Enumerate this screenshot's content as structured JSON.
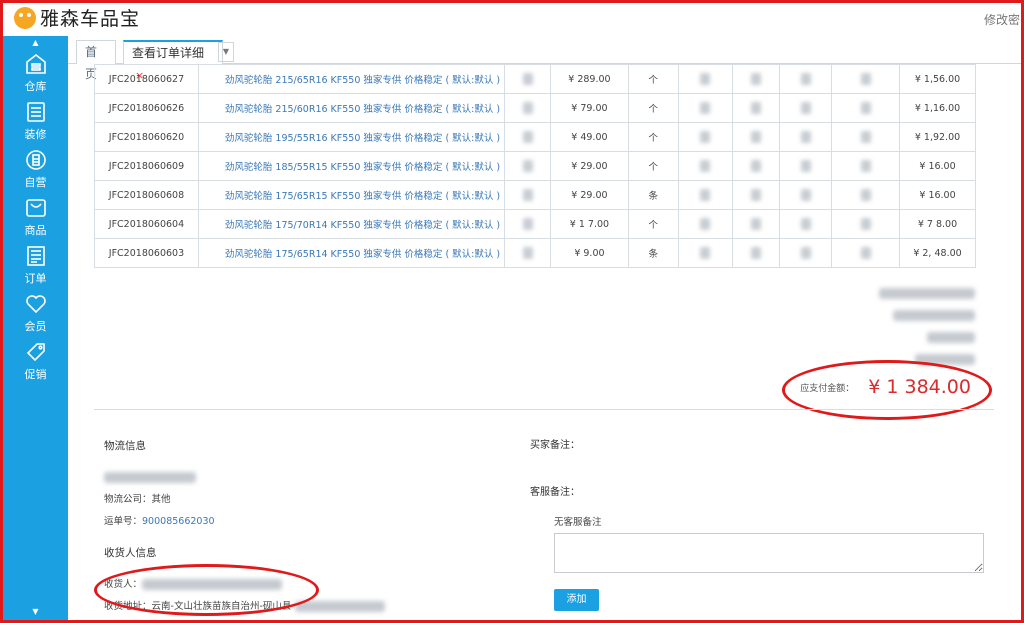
{
  "app": {
    "title": "雅森车品宝",
    "top_right": "修改密"
  },
  "sidebar": {
    "items": [
      {
        "label": "仓库",
        "icon": "warehouse-icon"
      },
      {
        "label": "装修",
        "icon": "decor-icon"
      },
      {
        "label": "自营",
        "icon": "self-op-icon"
      },
      {
        "label": "商品",
        "icon": "goods-icon"
      },
      {
        "label": "订单",
        "icon": "order-icon"
      },
      {
        "label": "会员",
        "icon": "heart-icon"
      },
      {
        "label": "促销",
        "icon": "tag-icon"
      }
    ]
  },
  "tabs": [
    {
      "label": "首页"
    },
    {
      "label": "查看订单详细",
      "close": "×"
    }
  ],
  "orders": {
    "rows": [
      {
        "sku": "JFC2018060627",
        "desc": "劲风驼轮胎 215/65R16 KF550 独家专供 价格稳定 ( 默认:默认 )",
        "price": "¥ 289.00",
        "unit": "个",
        "total": "¥ 1,56.00"
      },
      {
        "sku": "JFC2018060626",
        "desc": "劲风驼轮胎 215/60R16 KF550 独家专供 价格稳定 ( 默认:默认 )",
        "price": "¥ 79.00",
        "unit": "个",
        "total": "¥ 1,16.00"
      },
      {
        "sku": "JFC2018060620",
        "desc": "劲风驼轮胎 195/55R16 KF550 独家专供 价格稳定 ( 默认:默认 )",
        "price": "¥ 49.00",
        "unit": "个",
        "total": "¥ 1,92.00"
      },
      {
        "sku": "JFC2018060609",
        "desc": "劲风驼轮胎 185/55R15 KF550 独家专供 价格稳定 ( 默认:默认 )",
        "price": "¥ 29.00",
        "unit": "个",
        "total": "¥ 16.00"
      },
      {
        "sku": "JFC2018060608",
        "desc": "劲风驼轮胎 175/65R15 KF550 独家专供 价格稳定 ( 默认:默认 )",
        "price": "¥ 29.00",
        "unit": "条",
        "total": "¥ 16.00"
      },
      {
        "sku": "JFC2018060604",
        "desc": "劲风驼轮胎 175/70R14 KF550 独家专供 价格稳定 ( 默认:默认 )",
        "price": "¥ 1 7.00",
        "unit": "个",
        "total": "¥ 7 8.00"
      },
      {
        "sku": "JFC2018060603",
        "desc": "劲风驼轮胎 175/65R14 KF550 独家专供 价格稳定 ( 默认:默认 )",
        "price": "¥ 9.00",
        "unit": "条",
        "total": "¥ 2, 48.00"
      }
    ]
  },
  "summary": {
    "payable_label": "应支付金额：",
    "payable_amount": "¥ 1 384.00"
  },
  "logistics": {
    "title": "物流信息",
    "company_label": "物流公司：",
    "company": "其他",
    "tracking_label": "运单号：",
    "tracking": "900085662030"
  },
  "receiver": {
    "title": "收货人信息",
    "name_label": "收货人：",
    "address_label": "收货地址：",
    "address": "云南-文山壮族苗族自治州-砚山县-"
  },
  "notes": {
    "buyer_label": "买家备注：",
    "cs_label": "客服备注：",
    "cs_empty": "无客服备注",
    "add_button": "添加"
  },
  "colors": {
    "accent": "#1ba0e2",
    "highlight": "#e01a1a",
    "amount": "#d92b2b"
  }
}
